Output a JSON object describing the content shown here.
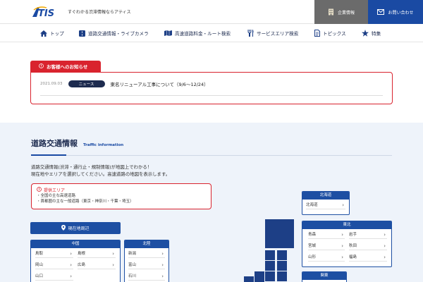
{
  "header": {
    "logo_text": "ATIS",
    "tagline": "すぐわかる渋滞情報ならアティス",
    "corp_label": "企業情報",
    "contact_label": "お問い合わせ"
  },
  "nav": {
    "items": [
      {
        "label": "トップ",
        "icon": "home-icon"
      },
      {
        "label": "道路交通情報・ライブカメラ",
        "icon": "road-icon"
      },
      {
        "label": "高速道路料金・ルート検索",
        "icon": "map-icon"
      },
      {
        "label": "サービスエリア検索",
        "icon": "fork-knife-icon"
      },
      {
        "label": "トピックス",
        "icon": "document-icon"
      },
      {
        "label": "特集",
        "icon": "star-icon"
      }
    ]
  },
  "notice": {
    "tab_label": "お客様へのお知らせ",
    "date": "2021.09.03",
    "category": "ニュース",
    "title": "東名リニューアル工事について（9/6～12/24）"
  },
  "traffic": {
    "title": "道路交通情報",
    "title_en": "Traffic information",
    "desc_line1": "道路交通情報(渋滞・通行止・規制情報)が地図上でわかる！",
    "desc_line2": "現在地やエリアを選択してください。高速道路の地図を表示します。",
    "area_heading": "提供エリア",
    "area_items": [
      "・全国の主な高速道路",
      "・首都圏の主な一般道路（東京・神奈川・千葉・埼玉）"
    ],
    "current_location_label": "現在地周辺"
  },
  "regions": {
    "chugoku": {
      "label": "中国",
      "prefs": [
        "鳥取",
        "島根",
        "岡山",
        "広島",
        "山口"
      ]
    },
    "hokuriku": {
      "label": "北陸",
      "prefs": [
        "新潟",
        "富山",
        "石川"
      ]
    },
    "hokkaido": {
      "label": "北海道",
      "prefs": [
        "北海道"
      ]
    },
    "tohoku": {
      "label": "東北",
      "prefs": [
        "青森",
        "岩手",
        "宮城",
        "秋田",
        "山形",
        "福島"
      ]
    },
    "kanto": {
      "label": "関東"
    }
  },
  "colors": {
    "accent_red": "#d9232e",
    "navy": "#1d2b4f",
    "blue": "#1d4fa3"
  }
}
